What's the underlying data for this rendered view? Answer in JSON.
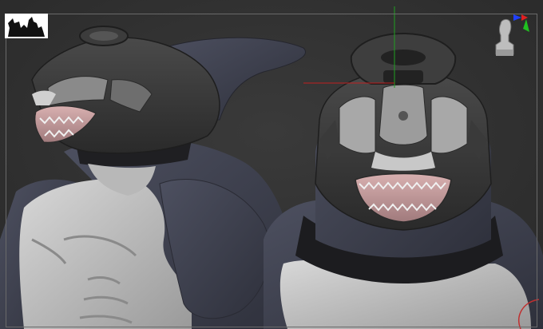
{
  "app": {
    "viewport_label": "",
    "background_color": "#333333",
    "frame_color": "#6a6a6a"
  },
  "logo": {
    "icon": "studio-silhouette-logo-icon",
    "background": "#ffffff"
  },
  "gizmo": {
    "icon": "view-orientation-head-gizmo-icon",
    "axes": {
      "x_color": "#e02020",
      "y_color": "#20c020",
      "z_color": "#2040ff"
    }
  },
  "models": [
    {
      "name": "orca-character-side-view",
      "icon": "orca-sculpt-side-icon"
    },
    {
      "name": "orca-character-front-view",
      "icon": "orca-sculpt-front-icon"
    }
  ],
  "colors": {
    "skin_dark": "#3f4150",
    "skin_light": "#bdbdbd",
    "armor": "#3a3a3a",
    "armor_highlight": "#6a6a6a",
    "mouth": "#c79a9c",
    "teeth": "#f0f0f0",
    "crosshair_red": "#c02020",
    "crosshair_green": "#20a020",
    "selection_circle": "#c03030"
  }
}
